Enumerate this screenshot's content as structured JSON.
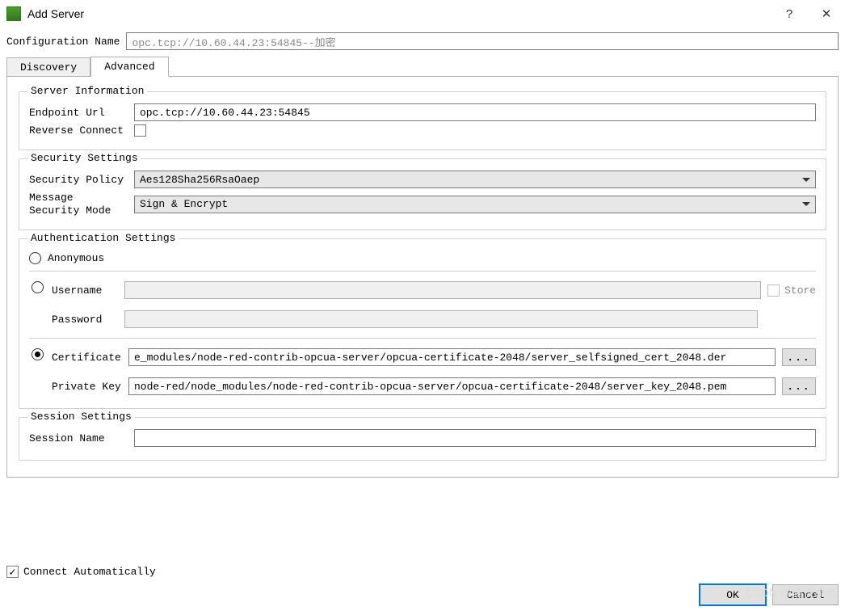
{
  "title": "Add Server",
  "help_icon": "?",
  "close_icon": "✕",
  "config": {
    "label": "Configuration Name",
    "value": "opc.tcp://10.60.44.23:54845--加密"
  },
  "tabs": {
    "discovery": "Discovery",
    "advanced": "Advanced"
  },
  "serverInfo": {
    "title": "Server Information",
    "endpoint_label": "Endpoint Url",
    "endpoint_value": "opc.tcp://10.60.44.23:54845",
    "reverse_label": "Reverse Connect"
  },
  "security": {
    "title": "Security Settings",
    "policy_label": "Security Policy",
    "policy_value": "Aes128Sha256RsaOaep",
    "mode_label_line1": "Message",
    "mode_label_line2": "Security Mode",
    "mode_value": "Sign & Encrypt"
  },
  "auth": {
    "title": "Authentication Settings",
    "anonymous": "Anonymous",
    "username_label": "Username",
    "username_value": "",
    "password_label": "Password",
    "password_value": "",
    "store_label": "Store",
    "certificate_label": "Certificate",
    "certificate_value": "e_modules/node-red-contrib-opcua-server/opcua-certificate-2048/server_selfsigned_cert_2048.der",
    "privatekey_label": "Private Key",
    "privatekey_value": "node-red/node_modules/node-red-contrib-opcua-server/opcua-certificate-2048/server_key_2048.pem",
    "browse": "..."
  },
  "session": {
    "title": "Session Settings",
    "name_label": "Session Name",
    "name_value": ""
  },
  "bottom": {
    "connect_auto": "Connect Automatically",
    "ok": "OK",
    "cancel": "Cancel"
  },
  "watermark": "CSDN @傻傻虎虎"
}
